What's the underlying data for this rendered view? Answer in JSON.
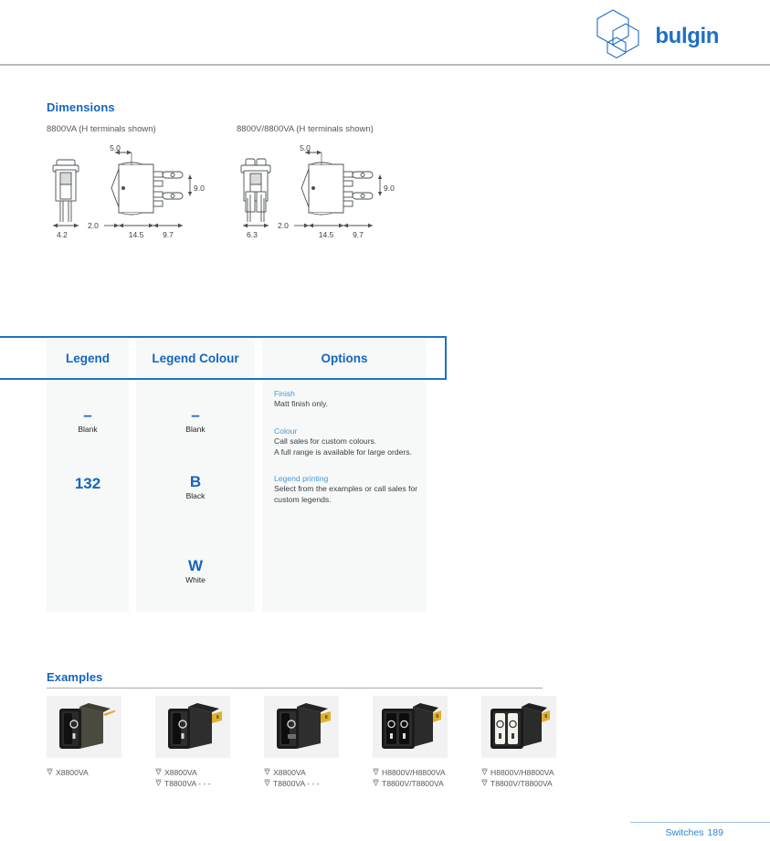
{
  "brand": {
    "name": "bulgin",
    "logo_icon": "hexagon-cube-logo",
    "color": "#1f6fc4"
  },
  "sections": {
    "dimensions": {
      "heading": "Dimensions"
    },
    "examples": {
      "heading": "Examples"
    }
  },
  "dimensions": {
    "drawings": [
      {
        "caption": "8800VA (H terminals shown)",
        "labels": {
          "top": "5.0",
          "right": "9.0",
          "left": "2.0",
          "b1": "14.5",
          "b2": "9.7",
          "front": "4.2"
        }
      },
      {
        "caption": "8800V/8800VA (H terminals shown)",
        "labels": {
          "top": "5.0",
          "right": "9.0",
          "left": "2.0",
          "b1": "14.5",
          "b2": "9.7",
          "front": "6.3"
        }
      }
    ]
  },
  "options_table": {
    "columns": [
      "Legend",
      "Legend Colour",
      "Options"
    ],
    "legend": [
      {
        "code": "–",
        "label": "Blank"
      },
      {
        "code": "132",
        "label": ""
      }
    ],
    "legend_colour": [
      {
        "code": "–",
        "label": "Blank"
      },
      {
        "code": "B",
        "label": "Black"
      },
      {
        "code": "W",
        "label": "White"
      }
    ],
    "options": [
      {
        "title": "Finish",
        "lines": [
          "Matt finish only."
        ]
      },
      {
        "title": "Colour",
        "lines": [
          "Call sales for custom colours.",
          "A full range is available for large orders."
        ]
      },
      {
        "title": "Legend printing",
        "lines": [
          "Select from the examples or call sales for",
          "custom legends."
        ]
      }
    ]
  },
  "examples": [
    {
      "photo_icon": "rocker-switch-single-olive",
      "lines": [
        "X8800VA"
      ]
    },
    {
      "photo_icon": "rocker-switch-single-black",
      "lines": [
        "X8800VA",
        "T8800VA - - -"
      ]
    },
    {
      "photo_icon": "rocker-switch-single-black-2",
      "lines": [
        "X8800VA",
        "T8800VA - - -"
      ]
    },
    {
      "photo_icon": "rocker-switch-double-black",
      "lines": [
        "H8800V/H8800VA",
        "T8800V/T8800VA"
      ]
    },
    {
      "photo_icon": "rocker-switch-double-white",
      "lines": [
        "H8800V/H8800VA",
        "T8800V/T8800VA"
      ]
    }
  ],
  "footer": {
    "label": "Switches",
    "page": "189"
  }
}
